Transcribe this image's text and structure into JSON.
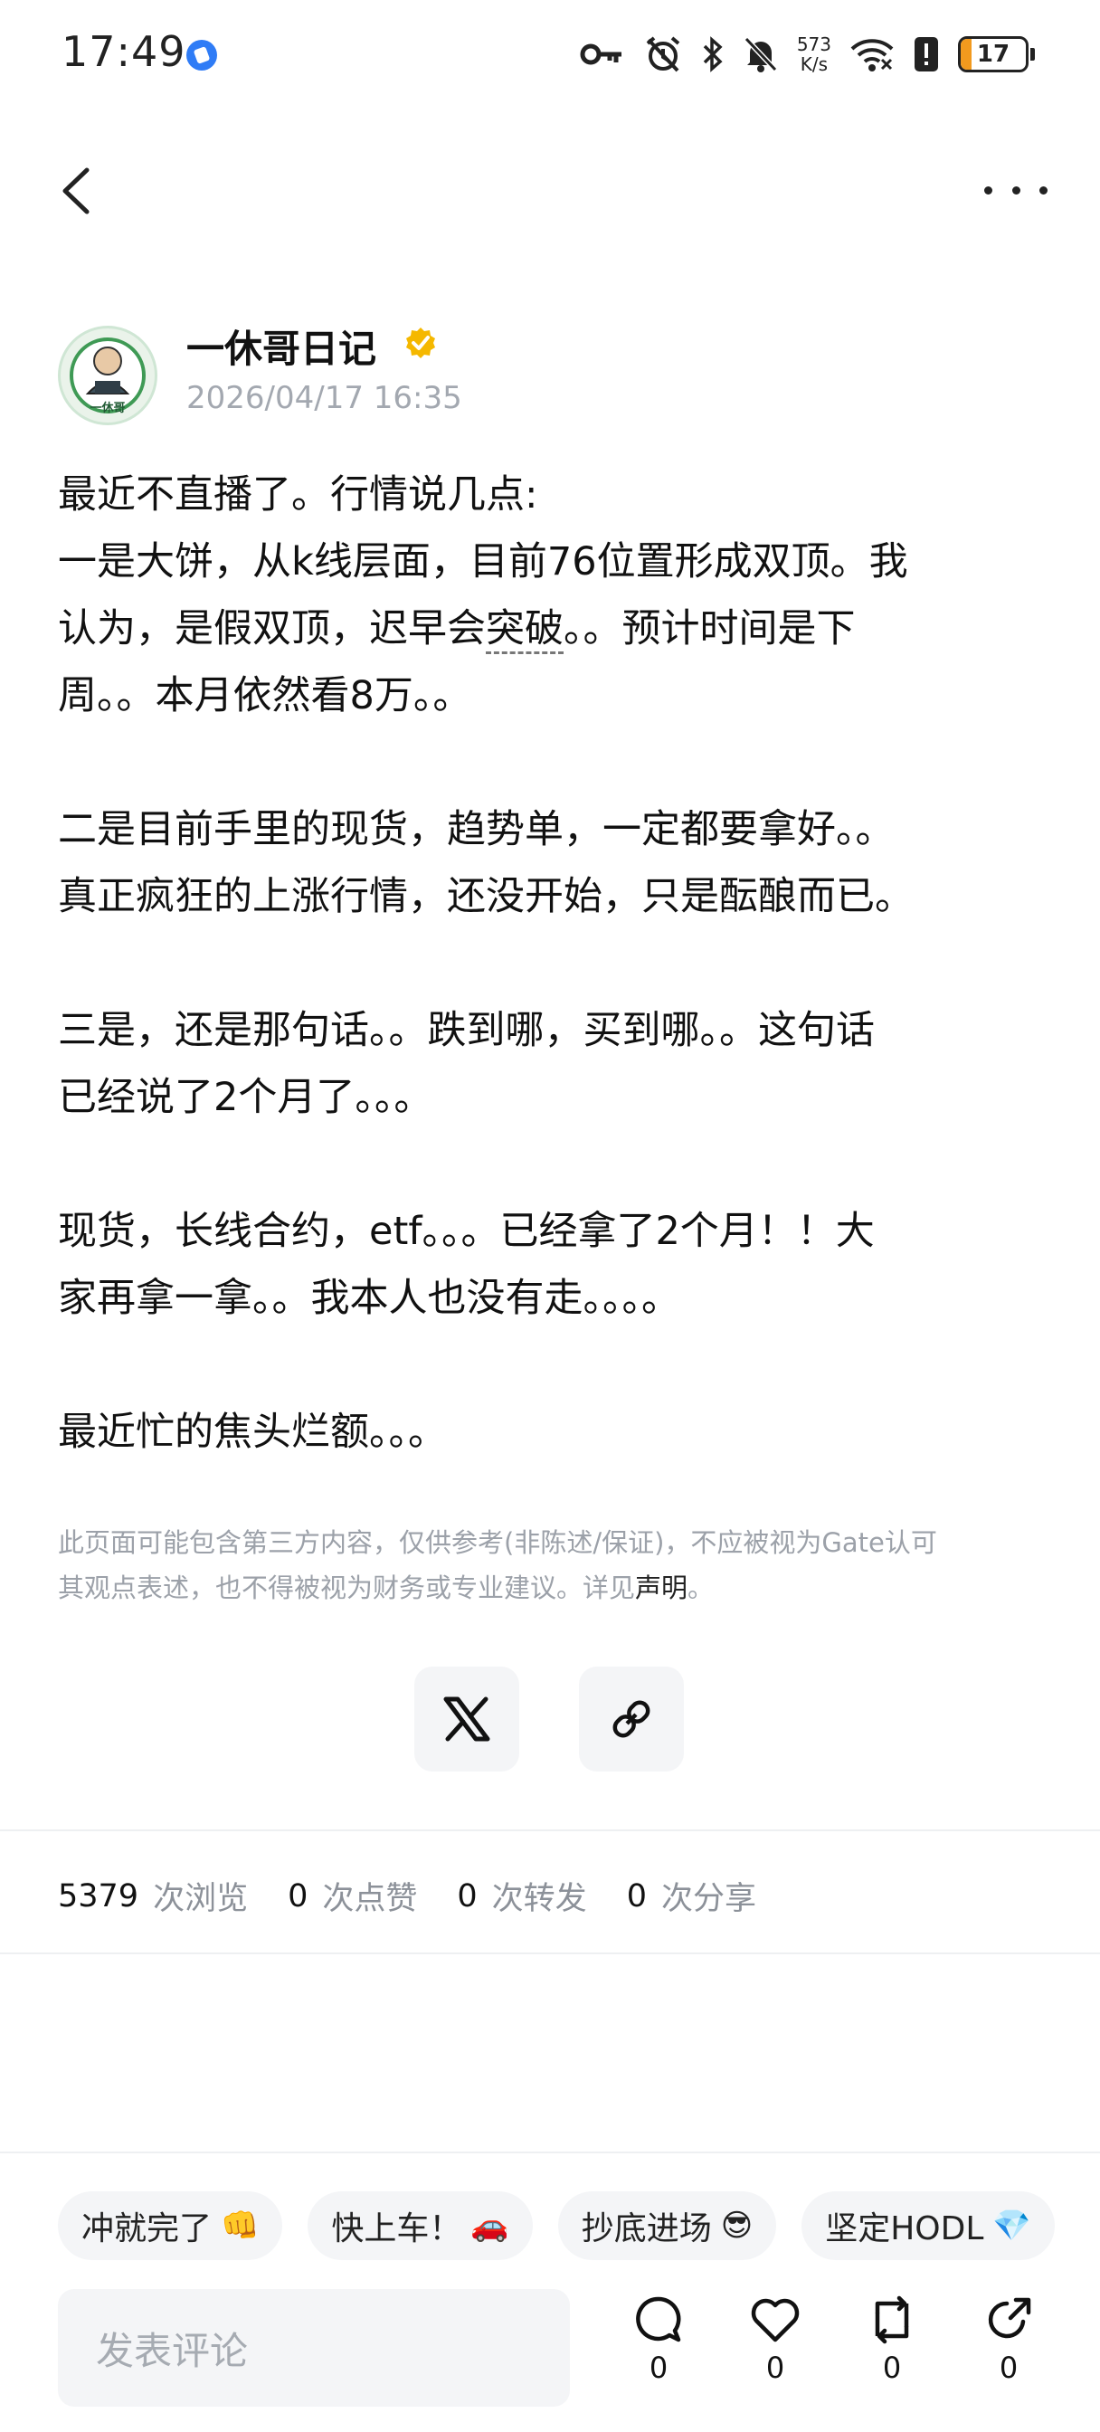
{
  "status_bar": {
    "time": "17:49",
    "speed_value": "573",
    "speed_unit": "K/s",
    "battery": "17",
    "battery_level": 0.17,
    "icons": [
      "key-icon",
      "alarm-icon",
      "bluetooth-icon",
      "mute-icon",
      "wifi-icon",
      "alert-icon",
      "battery-icon"
    ]
  },
  "header": {
    "back_icon": "chevron-left-icon",
    "more_icon": "more-dots-icon"
  },
  "author": {
    "name": "一休哥日记",
    "avatar_label": "一休哥",
    "badge_icon": "verified-badge-icon",
    "timestamp": "2026/04/17 16:35"
  },
  "post": {
    "p1_l1": "最近不直播了。行情说几点:",
    "p1_l2": "一是大饼，从k线层面，目前76位置形成双顶。我",
    "p1_l3a": "认为，是假双顶，迟早会",
    "p1_l3b": "突破",
    "p1_l3c": "。。预计时间是下",
    "p1_l4": "周。。本月依然看8万。。",
    "p2_l1": "二是目前手里的现货，趋势单，一定都要拿好。。",
    "p2_l2": "真正疯狂的上涨行情，还没开始，只是酝酿而已。",
    "p3_l1": "三是，还是那句话。。跌到哪，买到哪。。这句话",
    "p3_l2": "已经说了2个月了。。。",
    "p4_l1": "现货，长线合约，etf。。。已经拿了2个月！！大",
    "p4_l2": "家再拿一拿。。我本人也没有走。。。。",
    "p5_l1": "最近忙的焦头烂额。。。"
  },
  "disclaimer": {
    "line1": "此页面可能包含第三方内容，仅供参考(非陈述/保证)，不应被视为Gate认可",
    "line2": "其观点表述，也不得被视为财务或专业建议。详见",
    "link": "声明",
    "end": "。"
  },
  "share": {
    "x_icon": "x-logo-icon",
    "link_icon": "link-icon"
  },
  "stats": {
    "views": "5379",
    "views_label": "次浏览",
    "likes": "0",
    "likes_label": "次点赞",
    "reposts": "0",
    "reposts_label": "次转发",
    "shares": "0",
    "shares_label": "次分享"
  },
  "chips": [
    {
      "label": "冲就完了",
      "emoji": "👊"
    },
    {
      "label": "快上车！",
      "emoji": "🚗"
    },
    {
      "label": "抄底进场",
      "emoji": "😎"
    },
    {
      "label": "坚定HODL",
      "emoji": "💎"
    }
  ],
  "footer": {
    "comment_placeholder": "发表评论",
    "comment_count": "0",
    "like_count": "0",
    "repost_count": "0",
    "share_count": "0"
  },
  "colors": {
    "accent_orange": "#f29a1e",
    "status_blue": "#2f7cf6",
    "muted_text": "#a3a8b0",
    "badge_gold": "#f5b800"
  }
}
